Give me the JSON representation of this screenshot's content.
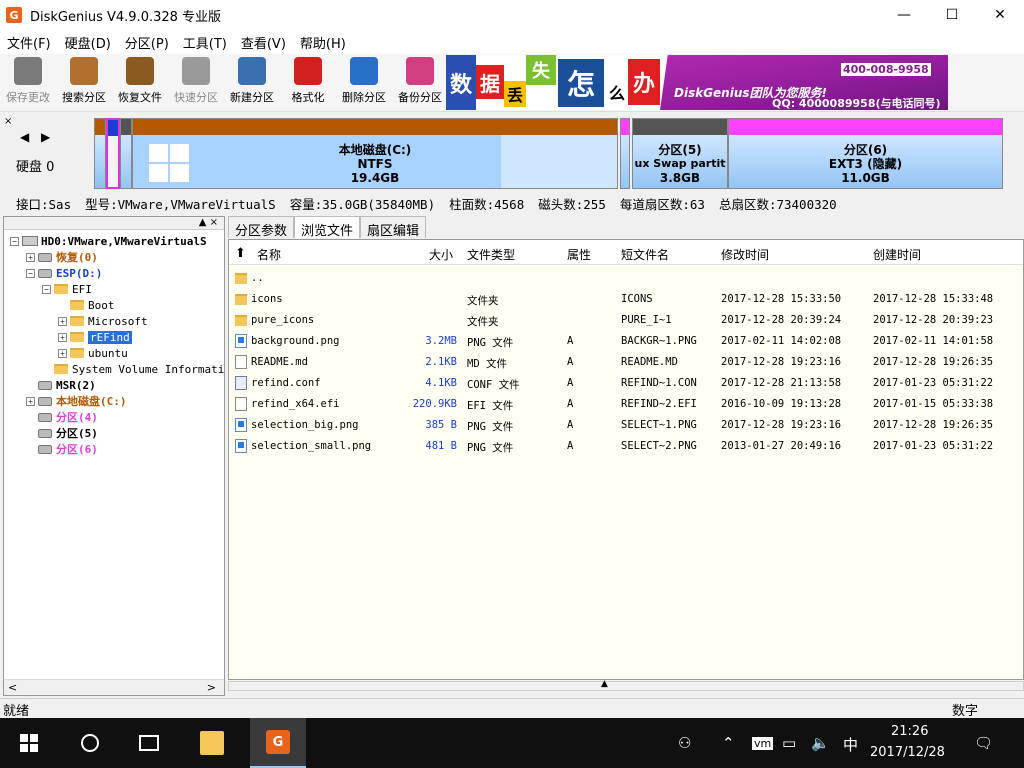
{
  "window": {
    "title": "DiskGenius V4.9.0.328 专业版",
    "app_icon": "G"
  },
  "menu": [
    "文件(F)",
    "硬盘(D)",
    "分区(P)",
    "工具(T)",
    "查看(V)",
    "帮助(H)"
  ],
  "toolbar": [
    {
      "label": "保存更改",
      "icon": "save-icon",
      "enabled": false,
      "color": "#7a7a7a"
    },
    {
      "label": "搜索分区",
      "icon": "magnifier-icon",
      "enabled": true,
      "color": "#b07030"
    },
    {
      "label": "恢复文件",
      "icon": "recover-box-icon",
      "enabled": true,
      "color": "#8a5a20"
    },
    {
      "label": "快速分区",
      "icon": "quick-partition-icon",
      "enabled": false,
      "color": "#9a9a9a"
    },
    {
      "label": "新建分区",
      "icon": "new-partition-icon",
      "enabled": true,
      "color": "#3a6fb0"
    },
    {
      "label": "格式化",
      "icon": "format-icon",
      "enabled": true,
      "color": "#d02020"
    },
    {
      "label": "删除分区",
      "icon": "delete-partition-icon",
      "enabled": true,
      "color": "#2a70c8"
    },
    {
      "label": "备份分区",
      "icon": "backup-pie-icon",
      "enabled": true,
      "color": "#d04080"
    }
  ],
  "banner": {
    "tiles": [
      "数",
      "据",
      "丢",
      "失",
      "怎",
      "么",
      "办"
    ],
    "team": "DiskGenius团队为您服务!",
    "phone": "400-008-9958",
    "qq": "QQ: 4000089958(与电话同号)"
  },
  "disk_panel": {
    "label": "硬盘 0",
    "arrows": "◀ ▶",
    "close": "×"
  },
  "partitions": [
    {
      "name": "本地磁盘(C:)",
      "fs": "NTFS",
      "size": "19.4GB",
      "color": "#b35a00"
    },
    {
      "name": "分区(5)",
      "fs": "ux Swap partit",
      "size": "3.8GB",
      "color": "#555555"
    },
    {
      "name": "分区(6)",
      "fs": "EXT3 (隐藏)",
      "size": "11.0GB",
      "color": "#ff40ff"
    }
  ],
  "info": {
    "interface": "接口:Sas",
    "model": "型号:VMware,VMwareVirtualS",
    "capacity": "容量:35.0GB(35840MB)",
    "cylinders": "柱面数:4568",
    "heads": "磁头数:255",
    "sectors_per_track": "每道扇区数:63",
    "total_sectors": "总扇区数:73400320"
  },
  "tree": [
    {
      "label": "HD0:VMware,VMwareVirtualS",
      "level": 0,
      "exp": "−",
      "type": "disk",
      "color": "#000"
    },
    {
      "label": "恢复(0)",
      "level": 1,
      "exp": "+",
      "type": "part",
      "color": "#b35a00"
    },
    {
      "label": "ESP(D:)",
      "level": 1,
      "exp": "−",
      "type": "part",
      "color": "#1a3fd0"
    },
    {
      "label": "EFI",
      "level": 2,
      "exp": "−",
      "type": "folder",
      "color": "#000"
    },
    {
      "label": "Boot",
      "level": 3,
      "exp": "",
      "type": "folder",
      "color": "#000"
    },
    {
      "label": "Microsoft",
      "level": 3,
      "exp": "+",
      "type": "folder",
      "color": "#000"
    },
    {
      "label": "rEFind",
      "level": 3,
      "exp": "+",
      "type": "folder",
      "color": "#fff",
      "selected": true
    },
    {
      "label": "ubuntu",
      "level": 3,
      "exp": "+",
      "type": "folder",
      "color": "#000"
    },
    {
      "label": "System Volume Informati",
      "level": 2,
      "exp": "",
      "type": "folder",
      "color": "#000"
    },
    {
      "label": "MSR(2)",
      "level": 1,
      "exp": "",
      "type": "part",
      "color": "#000"
    },
    {
      "label": "本地磁盘(C:)",
      "level": 1,
      "exp": "+",
      "type": "part",
      "color": "#b35a00"
    },
    {
      "label": "分区(4)",
      "level": 1,
      "exp": "",
      "type": "part",
      "color": "#e040e0"
    },
    {
      "label": "分区(5)",
      "level": 1,
      "exp": "",
      "type": "part",
      "color": "#000"
    },
    {
      "label": "分区(6)",
      "level": 1,
      "exp": "",
      "type": "part",
      "color": "#e040e0"
    }
  ],
  "tabs": [
    "分区参数",
    "浏览文件",
    "扇区编辑"
  ],
  "file_columns": [
    "名称",
    "大小",
    "文件类型",
    "属性",
    "短文件名",
    "修改时间",
    "创建时间"
  ],
  "files": [
    {
      "name": "..",
      "size": "",
      "type": "",
      "attr": "",
      "short": "",
      "mtime": "",
      "ctime": "",
      "icon": "folder"
    },
    {
      "name": "icons",
      "size": "",
      "type": "文件夹",
      "attr": "",
      "short": "ICONS",
      "mtime": "2017-12-28 15:33:50",
      "ctime": "2017-12-28 15:33:48",
      "icon": "folder"
    },
    {
      "name": "pure_icons",
      "size": "",
      "type": "文件夹",
      "attr": "",
      "short": "PURE_I~1",
      "mtime": "2017-12-28 20:39:24",
      "ctime": "2017-12-28 20:39:23",
      "icon": "folder"
    },
    {
      "name": "background.png",
      "size": "3.2MB",
      "type": "PNG 文件",
      "attr": "A",
      "short": "BACKGR~1.PNG",
      "mtime": "2017-02-11 14:02:08",
      "ctime": "2017-02-11 14:01:58",
      "icon": "img"
    },
    {
      "name": "README.md",
      "size": "2.1KB",
      "type": "MD 文件",
      "attr": "A",
      "short": "README.MD",
      "mtime": "2017-12-28 19:23:16",
      "ctime": "2017-12-28 19:26:35",
      "icon": "file"
    },
    {
      "name": "refind.conf",
      "size": "4.1KB",
      "type": "CONF 文件",
      "attr": "A",
      "short": "REFIND~1.CON",
      "mtime": "2017-12-28 21:13:58",
      "ctime": "2017-01-23 05:31:22",
      "icon": "cfg"
    },
    {
      "name": "refind_x64.efi",
      "size": "220.9KB",
      "type": "EFI 文件",
      "attr": "A",
      "short": "REFIND~2.EFI",
      "mtime": "2016-10-09 19:13:28",
      "ctime": "2017-01-15 05:33:38",
      "icon": "file"
    },
    {
      "name": "selection_big.png",
      "size": "385 B",
      "type": "PNG 文件",
      "attr": "A",
      "short": "SELECT~1.PNG",
      "mtime": "2017-12-28 19:23:16",
      "ctime": "2017-12-28 19:26:35",
      "icon": "img"
    },
    {
      "name": "selection_small.png",
      "size": "481 B",
      "type": "PNG 文件",
      "attr": "A",
      "short": "SELECT~2.PNG",
      "mtime": "2013-01-27 20:49:16",
      "ctime": "2017-01-23 05:31:22",
      "icon": "img"
    }
  ],
  "status": {
    "left": "就绪",
    "right": "数字"
  },
  "taskbar": {
    "time": "21:26",
    "date": "2017/12/28",
    "ime": "中"
  }
}
